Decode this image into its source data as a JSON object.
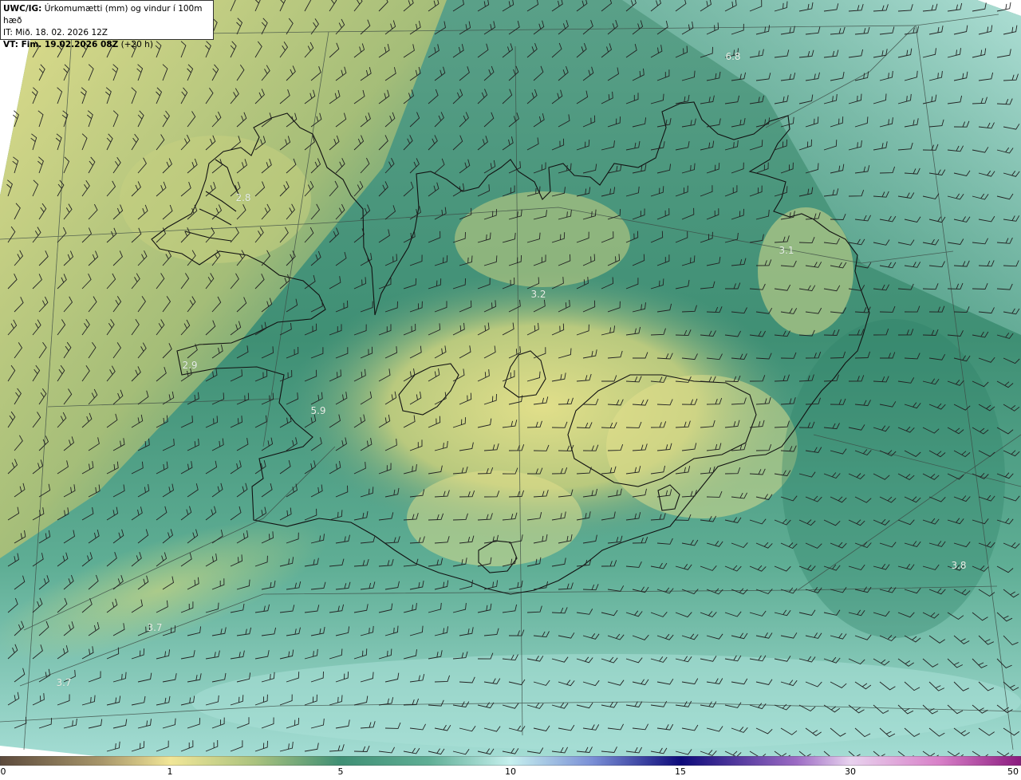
{
  "header": {
    "code": "UWC/IG:",
    "title": "Úrkomumætti (mm) og vindur í 100m hæð",
    "init_time": "IT: Mið. 18. 02. 2026 12Z",
    "valid_prefix": "VT: Fim. 19.02.2026 08Z",
    "valid_suffix": "(+20 h)"
  },
  "colors": {
    "dry": "#cfe08a",
    "low": "#e6e28f",
    "mid": "#3f8f74",
    "high": "#abe1d9",
    "coast": "#111111"
  },
  "map_labels": [
    {
      "text": "2.8"
    },
    {
      "text": "2.9"
    },
    {
      "text": "5.9"
    },
    {
      "text": "3.2"
    },
    {
      "text": "3.1"
    },
    {
      "text": "6.8"
    },
    {
      "text": "3.7"
    },
    {
      "text": "3.7"
    },
    {
      "text": "3.8"
    }
  ],
  "colorbar": {
    "ticks": [
      "0",
      "1",
      "5",
      "10",
      "15",
      "30",
      "50"
    ]
  }
}
